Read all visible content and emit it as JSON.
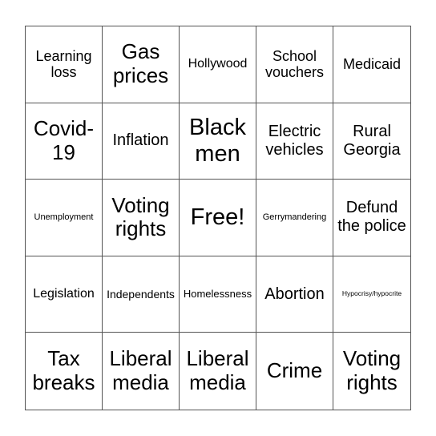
{
  "board": {
    "rows": [
      [
        {
          "text": "Learning loss",
          "size": "s-lg"
        },
        {
          "text": "Gas prices",
          "size": "s-xxl"
        },
        {
          "text": "Hollywood",
          "size": "s-m"
        },
        {
          "text": "School vouchers",
          "size": "s-lg"
        },
        {
          "text": "Medicaid",
          "size": "s-lg"
        }
      ],
      [
        {
          "text": "Covid-19",
          "size": "s-xxl"
        },
        {
          "text": "Inflation",
          "size": "s-l"
        },
        {
          "text": "Black men",
          "size": "s-xxxl"
        },
        {
          "text": "Electric vehicles",
          "size": "s-l"
        },
        {
          "text": "Rural Georgia",
          "size": "s-l"
        }
      ],
      [
        {
          "text": "Unemployment",
          "size": "s-sm"
        },
        {
          "text": "Voting rights",
          "size": "s-xxl"
        },
        {
          "text": "Free!",
          "size": "s-xxxl"
        },
        {
          "text": "Gerrymandering",
          "size": "s-sm"
        },
        {
          "text": "Defund the police",
          "size": "s-l"
        }
      ],
      [
        {
          "text": "Legislation",
          "size": "s-m"
        },
        {
          "text": "Independents",
          "size": "s-mdl"
        },
        {
          "text": "Homelessness",
          "size": "s-md"
        },
        {
          "text": "Abortion",
          "size": "s-l"
        },
        {
          "text": "Hypocrisy/hypocrite",
          "size": "s-xs"
        }
      ],
      [
        {
          "text": "Tax breaks",
          "size": "s-xxl"
        },
        {
          "text": "Liberal media",
          "size": "s-xxl"
        },
        {
          "text": "Liberal media",
          "size": "s-xxl"
        },
        {
          "text": "Crime",
          "size": "s-xxl"
        },
        {
          "text": "Voting rights",
          "size": "s-xxl"
        }
      ]
    ]
  }
}
